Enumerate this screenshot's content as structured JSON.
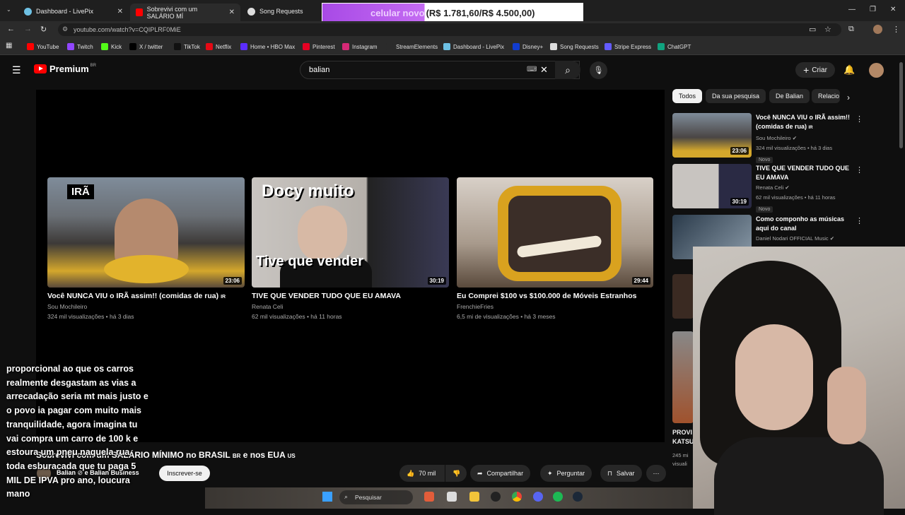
{
  "browser": {
    "tabs": [
      {
        "title": "Dashboard - LivePix",
        "color": "#6ec1e4"
      },
      {
        "title": "Sobrevivi com um SALÁRIO MÍ",
        "color": "#ff0000"
      },
      {
        "title": "Song Requests",
        "color": "#dddddd"
      }
    ],
    "url": "youtube.com/watch?v=CQIPLRF0MiE",
    "bookmarks": [
      "YouTube",
      "Twitch",
      "Kick",
      "X / twitter",
      "TikTok",
      "Netflix",
      "Home • HBO Max",
      "Pinterest",
      "Instagram",
      "StreamElements",
      "Dashboard - LivePix",
      "Disney+",
      "Song Requests",
      "Stripe Express",
      "ChatGPT"
    ]
  },
  "goal_overlay": {
    "label": "celular novo",
    "amount": "(R$ 1.781,60/R$ 4.500,00)",
    "progress": 0.396
  },
  "youtube": {
    "logo_text": "Premium",
    "region": "BR",
    "search_value": "balian",
    "create_label": "Criar"
  },
  "endscreen": [
    {
      "title": "Você NUNCA VIU o IRÃ assim!! (comidas de rua)",
      "flag": "IR",
      "channel": "Sou Mochileiro",
      "meta": "324 mil visualizações • há 3 dias",
      "duration": "23:06",
      "thumb_text": "IRÃ"
    },
    {
      "title": "TIVE QUE VENDER TUDO QUE EU AMAVA",
      "channel": "Renata Celi",
      "meta": "62 mil visualizações • há 11 horas",
      "duration": "30:19",
      "thumb_text": "Docy muito",
      "thumb_text2": "Tive que vender"
    },
    {
      "title": "Eu Comprei $100 vs $100.000 de Móveis Estranhos",
      "channel": "FrenchieFries",
      "meta": "6,5 mi de visualizações • há 3 meses",
      "duration": "29:44"
    }
  ],
  "video": {
    "title": "Sobrevivi com um SALÁRIO MÍNIMO no BRASIL",
    "flag_br": "BR",
    "title_mid": "e nos EUA",
    "flag_us": "US",
    "channel": "Balian",
    "channel_extra": "e Balian Business",
    "subscribe_label": "Inscrever-se",
    "likes": "70 mil",
    "share_label": "Compartilhar",
    "ask_label": "Perguntar",
    "save_label": "Salvar"
  },
  "chat_lines": [
    "proporcional ao que os carros",
    "realmente desgastam as vias a",
    "arrecadação seria mt mais justo e",
    "o povo ia pagar com muito mais",
    "tranquilidade, agora imagina tu",
    "vai compra um carro de 100 k e",
    "estoura um pneu naquela rua",
    "toda esburacada que tu paga 5",
    "MIL DE IPVA pro ano, loucura",
    "mano"
  ],
  "chips": [
    "Todos",
    "Da sua pesquisa",
    "De Balian",
    "Relacio"
  ],
  "related": [
    {
      "title": "Você NUNCA VIU o IRÃ assim!! (comidas de rua)",
      "flag": "IR",
      "channel": "Sou Mochileiro",
      "meta": "324 mil visualizações • há 3 dias",
      "badge": "Novo",
      "duration": "23:06"
    },
    {
      "title": "TIVE QUE VENDER TUDO QUE EU AMAVA",
      "channel": "Renata Celi",
      "meta": "62 mil visualizações • há 11 horas",
      "badge": "Novo",
      "duration": "30:19"
    },
    {
      "title": "Como componho as músicas aqui do canal",
      "channel": "Daniel Nodari OFFICIAL Music",
      "meta": "",
      "badge": "",
      "duration": ""
    }
  ],
  "related_partial": {
    "title": "PROVI KATSU",
    "meta": "245 mi visuali"
  },
  "taskbar": {
    "search_label": "Pesquisar"
  },
  "colors": {
    "yt_red": "#ff0000",
    "goal_purple": "#b45cec",
    "bg": "#0f0f0f"
  }
}
